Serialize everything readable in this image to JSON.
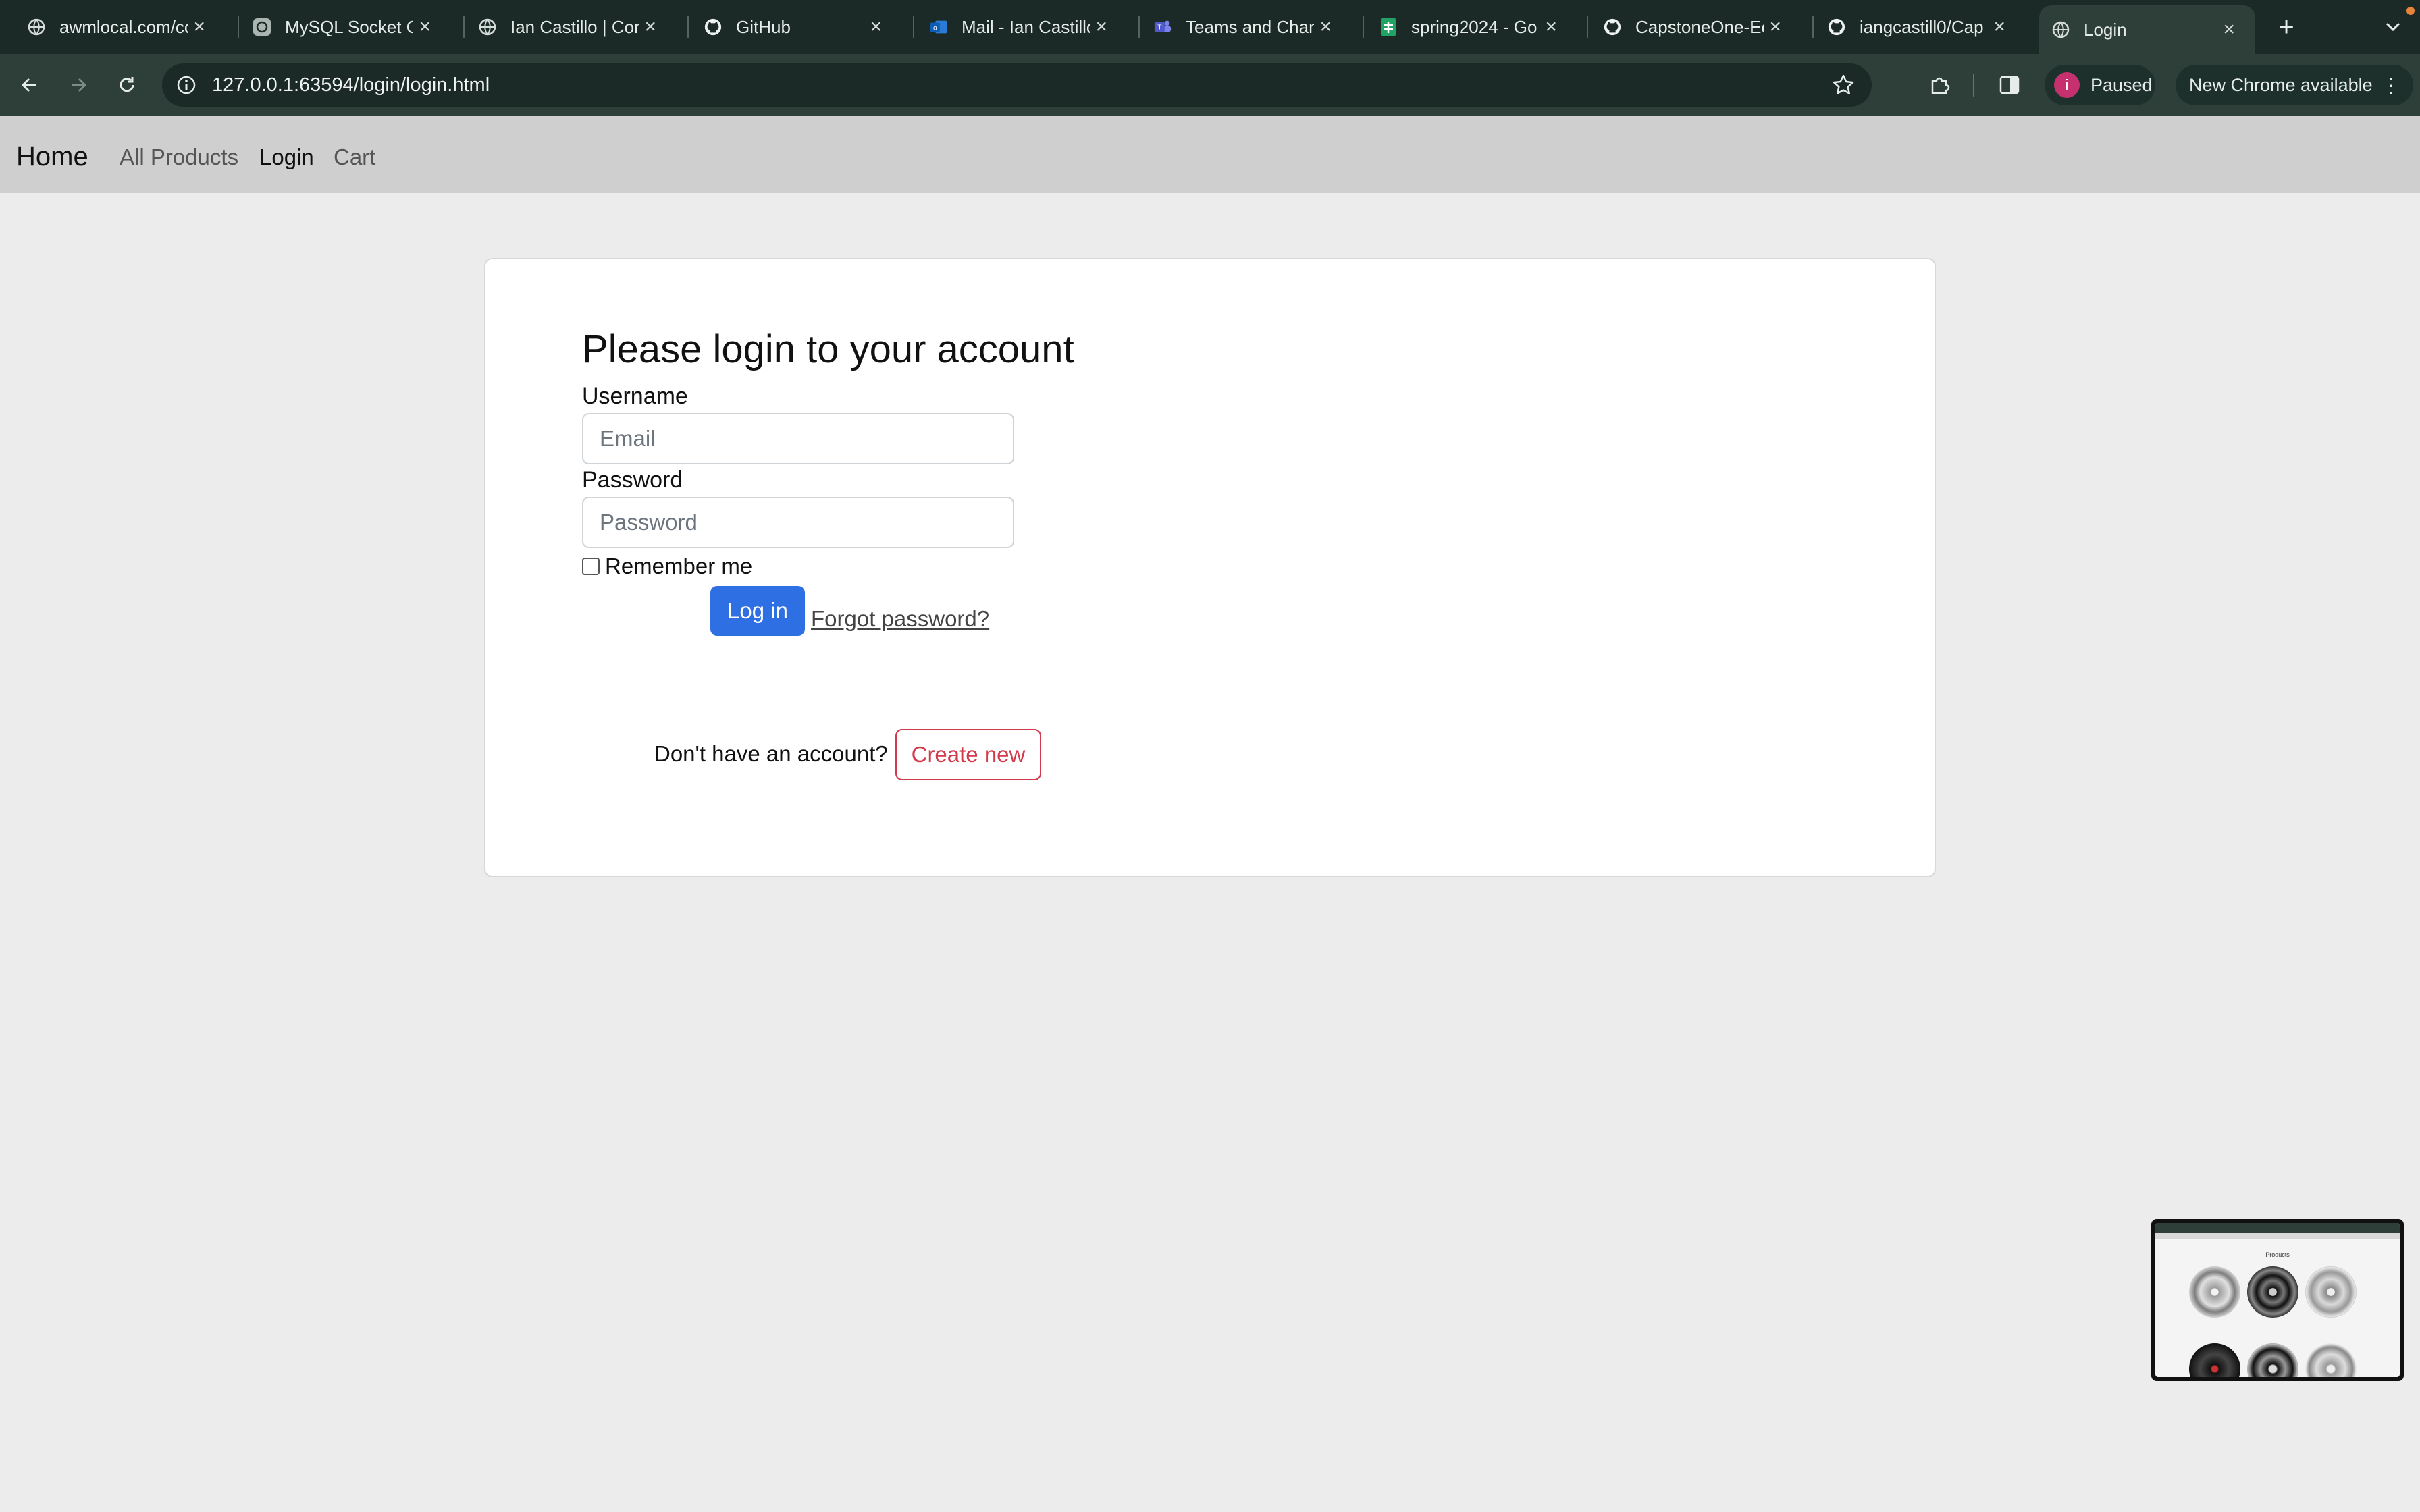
{
  "browser": {
    "tabs": [
      {
        "label": "awmlocal.com/cc",
        "icon": "globe-icon",
        "active": false
      },
      {
        "label": "MySQL Socket C",
        "icon": "chatgpt-icon",
        "active": false
      },
      {
        "label": "Ian Castillo | Con",
        "icon": "globe-icon",
        "active": false
      },
      {
        "label": "GitHub",
        "icon": "github-icon",
        "active": false
      },
      {
        "label": "Mail - Ian Castillo",
        "icon": "outlook-icon",
        "active": false
      },
      {
        "label": "Teams and Chan",
        "icon": "teams-icon",
        "active": false
      },
      {
        "label": "spring2024 - Go",
        "icon": "sheets-icon",
        "active": false
      },
      {
        "label": "CapstoneOne-Ec",
        "icon": "github-icon",
        "active": false
      },
      {
        "label": "iangcastill0/Cap",
        "icon": "github-icon",
        "active": false
      },
      {
        "label": "Login",
        "icon": "globe-icon",
        "active": true
      }
    ],
    "new_tab": "+",
    "url": "127.0.0.1:63594/login/login.html",
    "profile": {
      "initial": "i",
      "label": "Paused"
    },
    "update_label": "New Chrome available",
    "colors": {
      "frame": "#1b2a26",
      "toolbar": "#2e3f3a",
      "avatar": "#c7306e"
    }
  },
  "site_nav": {
    "brand": "Home",
    "links": [
      "All Products",
      "Login",
      "Cart"
    ]
  },
  "login": {
    "heading": "Please login to your account",
    "username_label": "Username",
    "username_placeholder": "Email",
    "password_label": "Password",
    "password_placeholder": "Password",
    "remember_label": "Remember me",
    "login_button": "Log in",
    "forgot_link": "Forgot password?",
    "no_account_text": "Don't have an account?",
    "create_button": "Create new",
    "colors": {
      "primary": "#2f6fe4",
      "danger": "#d13b4b"
    }
  },
  "pip": {
    "title": "Products"
  }
}
